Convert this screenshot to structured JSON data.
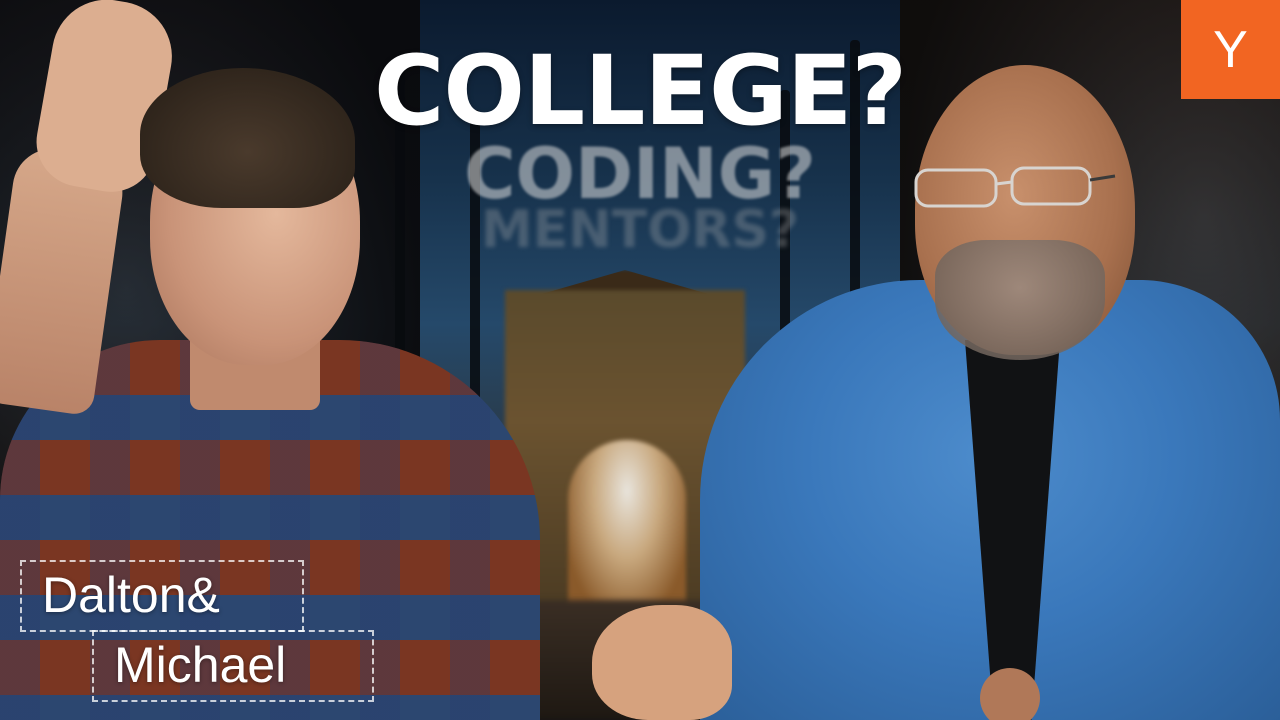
{
  "headline": {
    "primary": "COLLEGE?",
    "secondary": "CODING?",
    "tertiary": "MENTORS?"
  },
  "logo": {
    "letter": "Y",
    "color": "#f26522"
  },
  "names": {
    "first": "Dalton&",
    "second": "Michael"
  }
}
